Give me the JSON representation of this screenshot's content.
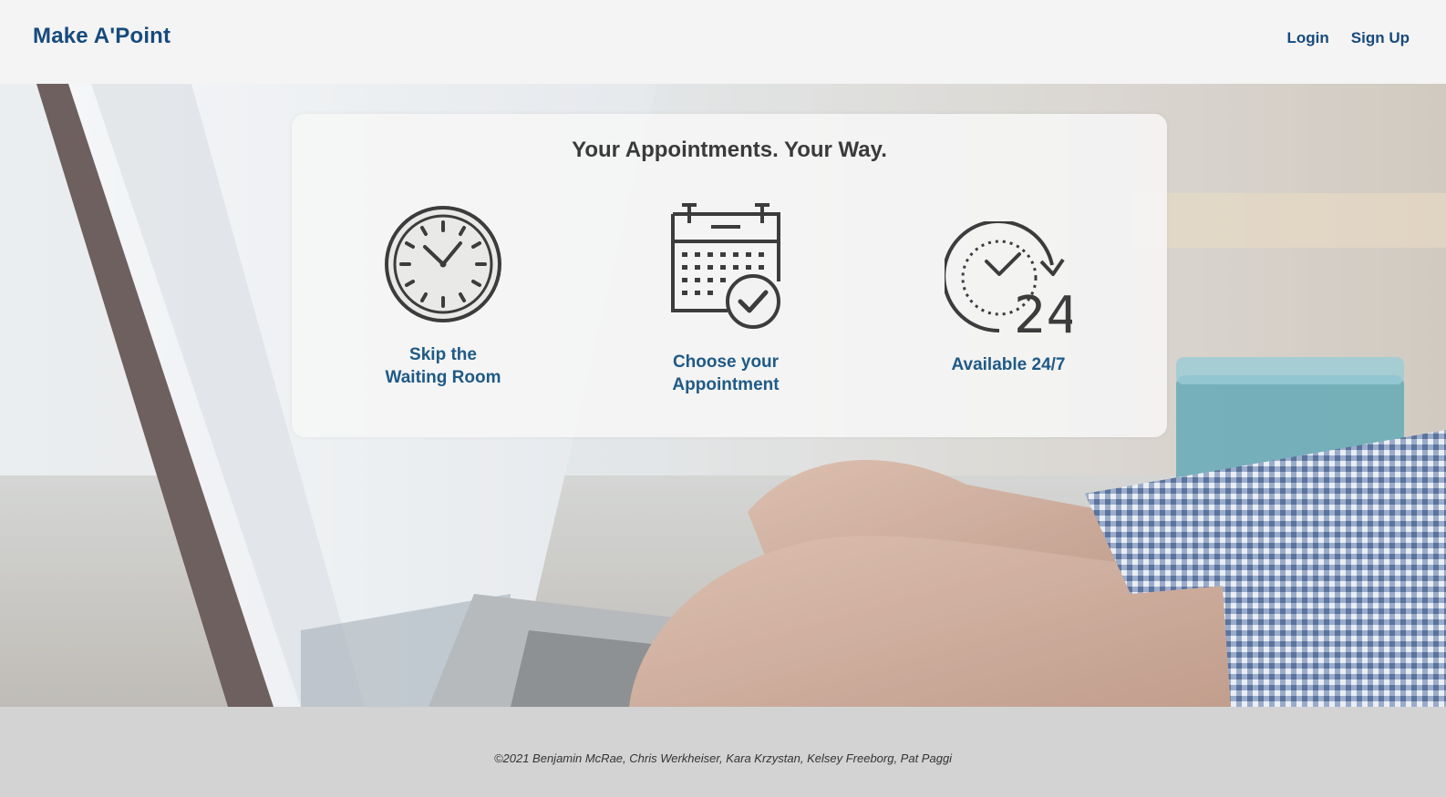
{
  "header": {
    "brand": "Make A'Point",
    "nav": {
      "login": "Login",
      "signup": "Sign Up"
    }
  },
  "hero": {
    "title": "Your Appointments. Your Way.",
    "features": [
      {
        "icon": "clock-icon",
        "label": "Skip the\nWaiting Room"
      },
      {
        "icon": "calendar-check-icon",
        "label": "Choose your\nAppointment"
      },
      {
        "icon": "available-24-7-icon",
        "label": "Available 24/7"
      }
    ]
  },
  "footer": {
    "text": "©2021 Benjamin McRae, Chris Werkheiser, Kara Krzystan, Kelsey Freeborg, Pat Paggi"
  },
  "colors": {
    "brand": "#174a7c",
    "feature_label": "#1f5a86",
    "navbar_bg": "#f4f4f4",
    "footer_bg": "#d3d3d3"
  }
}
